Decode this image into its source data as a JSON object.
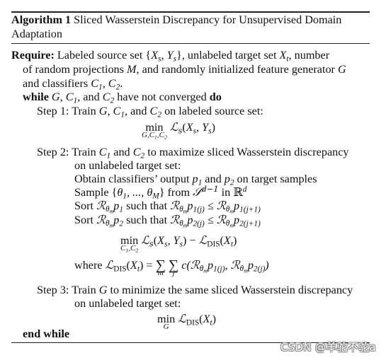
{
  "algorithm": {
    "label": "Algorithm 1",
    "title_line1": "Sliced Wasserstein Discrepancy for Unsupervised Domain",
    "title_line2": "Adaptation"
  },
  "require": {
    "label": "Require:",
    "line1_a": "Labeled source set {",
    "line1_b": "}, unlabeled target set ",
    "line1_c": ", number",
    "line2_a": "of random projections ",
    "line2_b": ", and randomly initialized feature generator ",
    "line3_a": "and classifiers ",
    "line3_b": "."
  },
  "loop": {
    "while_kw": "while",
    "while_text_a": ", ",
    "while_text_b": ", and ",
    "while_text_c": " have not converged ",
    "do_kw": "do",
    "end_kw": "end while"
  },
  "steps": [
    {
      "label": "Step 1:",
      "text": "Train G, C1, and C2 on labeled source set:",
      "equation": "min_{G,C1,C2} Ls(Xs, Ys)"
    },
    {
      "label": "Step 2:",
      "text_line1": "Train C1 and C2 to maximize sliced Wasserstein discrepancy",
      "text_line2": "on unlabeled target set:",
      "substeps": [
        "Obtain classifiers’ output p1 and p2 on target samples",
        "Sample {θ1, ..., θM} from S^(d−1) in R^d",
        "Sort Rθm p1 such that Rθm p1(j) ≤ Rθm p1(j+1)",
        "Sort Rθm p2 such that Rθm p2(j) ≤ Rθm p2(j+1)"
      ],
      "equation": "min_{C1,C2} Ls(Xs, Ys) − LDIS(Xt)",
      "where": "where LDIS(Xt) = Σm Σj c(Rθm p1(j), Rθm p2(j))"
    },
    {
      "label": "Step 3:",
      "text_line1": "Train G to minimize the same sliced Wasserstein discrepancy",
      "text_line2": "on unlabeled target set:",
      "equation": "min_G LDIS(Xt)"
    }
  ],
  "text": {
    "train": "Train ",
    "comma": ", ",
    "and": "and ",
    "comma_and": ", and ",
    "on_labeled": " on labeled source set:",
    "and_sp": " and ",
    "to_max": " to maximize sliced Wasserstein discrepancy",
    "on_unlabeled": "on unlabeled target set:",
    "obtain": "Obtain classifiers’ output ",
    "on_target": " on target samples",
    "sample": "Sample {",
    "from": "} from ",
    "in": " in ",
    "sort": "Sort ",
    "such_that": " such that ",
    "where": "where ",
    "to_min": " to minimize the same sliced Wasserstein discrepancy",
    "min": "min"
  },
  "watermark": "CSDN @羊驼不驼a"
}
